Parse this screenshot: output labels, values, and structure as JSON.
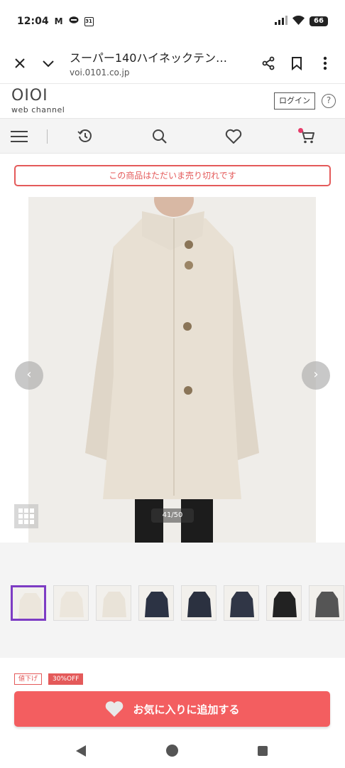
{
  "status_bar": {
    "time": "12:04",
    "notification_icons": [
      "gmail-icon",
      "chat-icon",
      "calendar-icon"
    ],
    "calendar_day": "31",
    "battery": "66"
  },
  "browser": {
    "page_title": "スーパー140ハイネックテン…",
    "url": "voi.0101.co.jp"
  },
  "site": {
    "logo_main": "OIOI",
    "logo_sub": "web channel",
    "login_label": "ログイン",
    "help_label": "?"
  },
  "product": {
    "soldout_message": "この商品はただいま売り切れです",
    "image_counter": "41/50",
    "badge_sale": "値下げ",
    "badge_off": "30%OFF",
    "favorite_label": "お気に入りに追加する",
    "thumbnails": [
      {
        "name": "coat-front",
        "color": "#ece6dc"
      },
      {
        "name": "button-detail",
        "color": "#ece6dc"
      },
      {
        "name": "fabric-detail",
        "color": "#e9e3d8"
      },
      {
        "name": "navy-coat",
        "color": "#2c3344"
      },
      {
        "name": "navy-button-detail",
        "color": "#2b3140"
      },
      {
        "name": "navy-fabric",
        "color": "#303646"
      },
      {
        "name": "black-coat",
        "color": "#222"
      },
      {
        "name": "grey-coat",
        "color": "#555"
      }
    ]
  },
  "colors": {
    "accent_red": "#f35e60",
    "soldout_red": "#e45a5a",
    "thumb_active": "#7d3cc4",
    "cart_dot": "#e63c6a"
  }
}
